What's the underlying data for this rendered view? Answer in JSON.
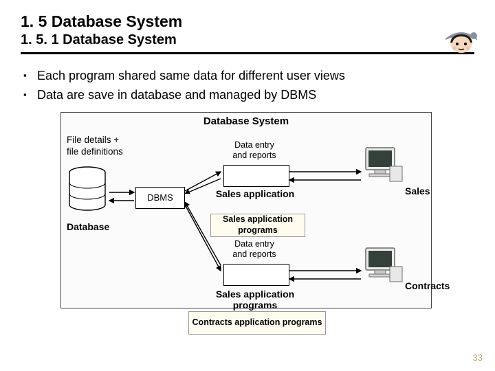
{
  "title": "1. 5 Database System",
  "subtitle": "1. 5. 1 Database System",
  "bullets": [
    "Each program shared same data for different user views",
    "Data are save in database and managed by DBMS"
  ],
  "diagram": {
    "title": "Database System",
    "file_details_line1": "File details +",
    "file_details_line2": "file definitions",
    "database_label": "Database",
    "dbms": "DBMS",
    "data_entry_line1": "Data entry",
    "data_entry_line2": "and reports",
    "app_label_1": "Sales application",
    "app_label_2": "Sales application programs",
    "monitor_label_1": "Sales",
    "monitor_label_2": "Contracts",
    "overlay_1": "Sales application programs",
    "overlay_2": "Contracts application programs"
  },
  "page_number": "33"
}
